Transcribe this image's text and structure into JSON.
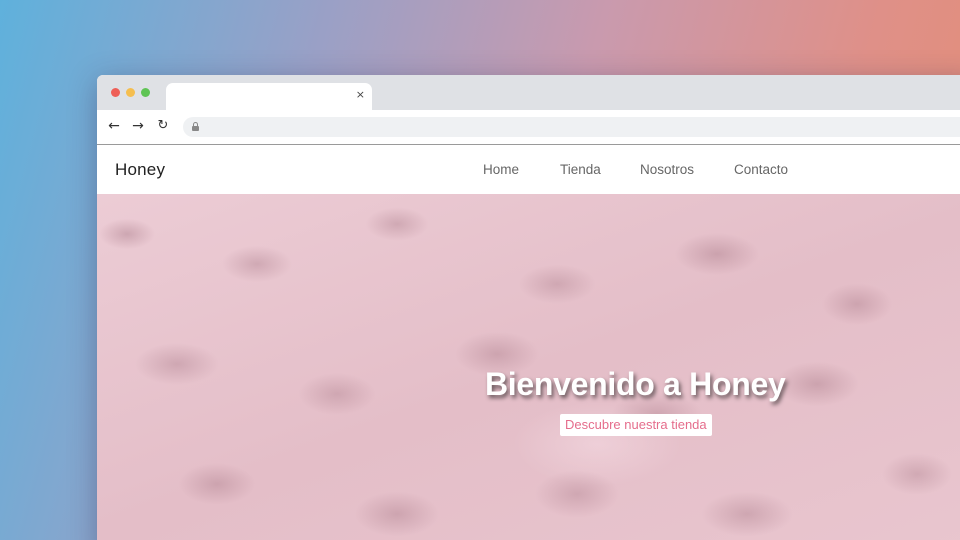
{
  "browser": {
    "tab": {
      "title": "",
      "close_glyph": "×"
    },
    "toolbar": {
      "back_glyph": "←",
      "forward_glyph": "→",
      "reload_glyph": "↻",
      "address": ""
    },
    "controls": {
      "close": "#ee5f57",
      "minimize": "#f5be4f",
      "maximize": "#5fc454"
    }
  },
  "site": {
    "brand": "Honey",
    "nav": [
      "Home",
      "Tienda",
      "Nosotros",
      "Contacto"
    ],
    "hero": {
      "title": "Bienvenido a Honey",
      "cta": "Descubre nuestra tienda"
    }
  },
  "colors": {
    "accent": "#e56d8c",
    "hero_background": "#e6c3cc"
  }
}
